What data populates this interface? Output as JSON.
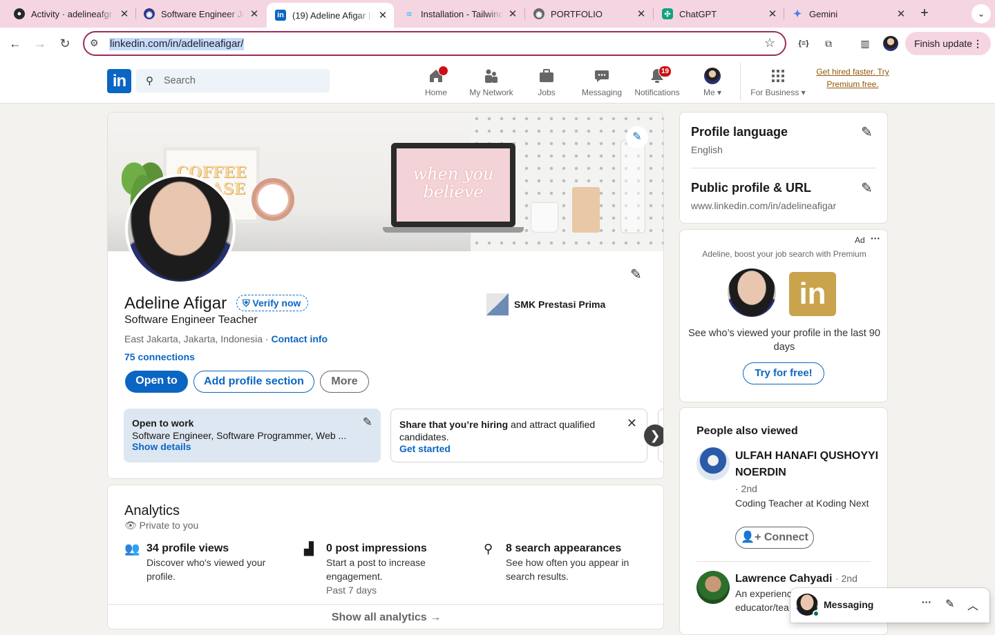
{
  "browser": {
    "tabs": [
      {
        "title": "Activity · adelineafgr",
        "icon": "github-icon"
      },
      {
        "title": "Software Engineer Jo",
        "icon": "globe-icon"
      },
      {
        "title": "(19) Adeline Afigar | L",
        "icon": "linkedin-icon",
        "active": true
      },
      {
        "title": "Installation - Tailwind",
        "icon": "tailwind-icon"
      },
      {
        "title": "PORTFOLIO",
        "icon": "globe-icon"
      },
      {
        "title": "ChatGPT",
        "icon": "chatgpt-icon"
      },
      {
        "title": "Gemini",
        "icon": "gemini-icon"
      }
    ],
    "url": "linkedin.com/in/adelineafigar/",
    "finish_update": "Finish update",
    "accent": "#f6d5e3"
  },
  "nav": {
    "logo": "in",
    "search_placeholder": "Search",
    "items": [
      {
        "label": "Home",
        "icon": "home-icon",
        "badge": ""
      },
      {
        "label": "My Network",
        "icon": "network-icon",
        "badge": ""
      },
      {
        "label": "Jobs",
        "icon": "briefcase-icon",
        "badge": ""
      },
      {
        "label": "Messaging",
        "icon": "messaging-icon",
        "badge": ""
      },
      {
        "label": "Notifications",
        "icon": "bell-icon",
        "badge": "19"
      },
      {
        "label": "Me",
        "icon": "avatar",
        "badge": ""
      }
    ],
    "for_business": "For Business",
    "premium_link": "Get hired faster. Try Premium free."
  },
  "profile": {
    "banner_text": "when you believe",
    "frame_text": "COFFEE PLEASE",
    "name": "Adeline Afigar",
    "verify": "Verify now",
    "headline": "Software Engineer Teacher",
    "location": "East Jakarta, Jakarta, Indonesia",
    "separator": " · ",
    "contact_info": "Contact info",
    "connections": "75 connections",
    "education": "SMK Prestasi Prima",
    "buttons": {
      "open_to": "Open to",
      "add_section": "Add profile section",
      "more": "More"
    },
    "open_to_work": {
      "title": "Open to work",
      "roles": "Software Engineer, Software Programmer, Web ...",
      "link": "Show details"
    },
    "hiring": {
      "bold": "Share that you’re hiring",
      "rest": " and attract qualified candidates.",
      "link": "Get started"
    }
  },
  "analytics": {
    "title": "Analytics",
    "privacy": "Private to you",
    "stats": [
      {
        "title": "34 profile views",
        "desc": "Discover who's viewed your profile.",
        "meta": "",
        "icon": "people-icon"
      },
      {
        "title": "0 post impressions",
        "desc": "Start a post to increase engagement.",
        "meta": "Past 7 days",
        "icon": "bar-chart-icon"
      },
      {
        "title": "8 search appearances",
        "desc": "See how often you appear in search results.",
        "meta": "",
        "icon": "search-icon"
      }
    ],
    "show_all": "Show all analytics →"
  },
  "sidebar": {
    "profile_language": {
      "title": "Profile language",
      "value": "English"
    },
    "public_profile": {
      "title": "Public profile & URL",
      "value": "www.linkedin.com/in/adelineafigar"
    },
    "ad": {
      "label": "Ad",
      "tagline": "Adeline, boost your job search with Premium",
      "logo_text": "in",
      "text": "See who’s viewed your profile in the last 90 days",
      "cta": "Try for free!"
    },
    "people": {
      "title": "People also viewed",
      "list": [
        {
          "name": "ULFAH HANAFI QUSHOYYI NOERDIN",
          "degree": "· 2nd",
          "headline": "Coding Teacher at Koding Next",
          "cta": "Connect"
        },
        {
          "name": "Lawrence Cahyadi",
          "degree": "· 2nd",
          "headline": "An experienced educator/tea"
        }
      ]
    }
  },
  "messaging": {
    "label": "Messaging"
  }
}
